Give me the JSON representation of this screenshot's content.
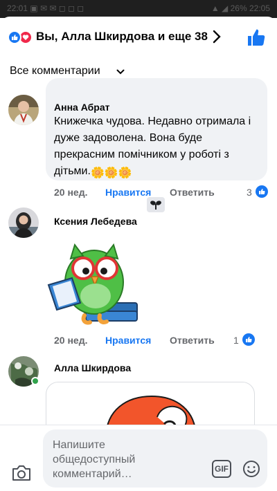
{
  "status_bar": {
    "left_text": "22:01 ▣ ✉ ✉ ◻ ◻ ◻",
    "right_text": "▲ ◢ 26% 22:05"
  },
  "header": {
    "title": "Вы, Алла Шкирдова и еще 38",
    "reactions": [
      "like-icon",
      "love-icon"
    ]
  },
  "filter": {
    "label": "Все комментарии"
  },
  "comments": [
    {
      "author": "Анна Абрат",
      "text": "Книжечка чудова. Недавно отримала і дуже задоволена. Вона буде прекрасним помічником у роботі з дітьми.",
      "emojis": "🌼🌼🌼",
      "time": "20 нед.",
      "like_label": "Нравится",
      "reply_label": "Ответить",
      "reaction_count": "3"
    },
    {
      "author": "Ксения Лебедева",
      "badge": "sprout-badge",
      "sticker": "owl-reading-book-sticker",
      "time": "20 нед.",
      "like_label": "Нравится",
      "reply_label": "Ответить",
      "reaction_count": "1"
    },
    {
      "author": "Алла Шкирдова",
      "image": "cartoon-image"
    }
  ],
  "composer": {
    "placeholder": "Напишите общедоступный комментарий…",
    "gif_label": "GIF"
  },
  "colors": {
    "accent": "#1877f2",
    "love": "#f0284a",
    "muted": "#65676b",
    "bubble": "#f0f2f5",
    "online": "#31a24c"
  }
}
